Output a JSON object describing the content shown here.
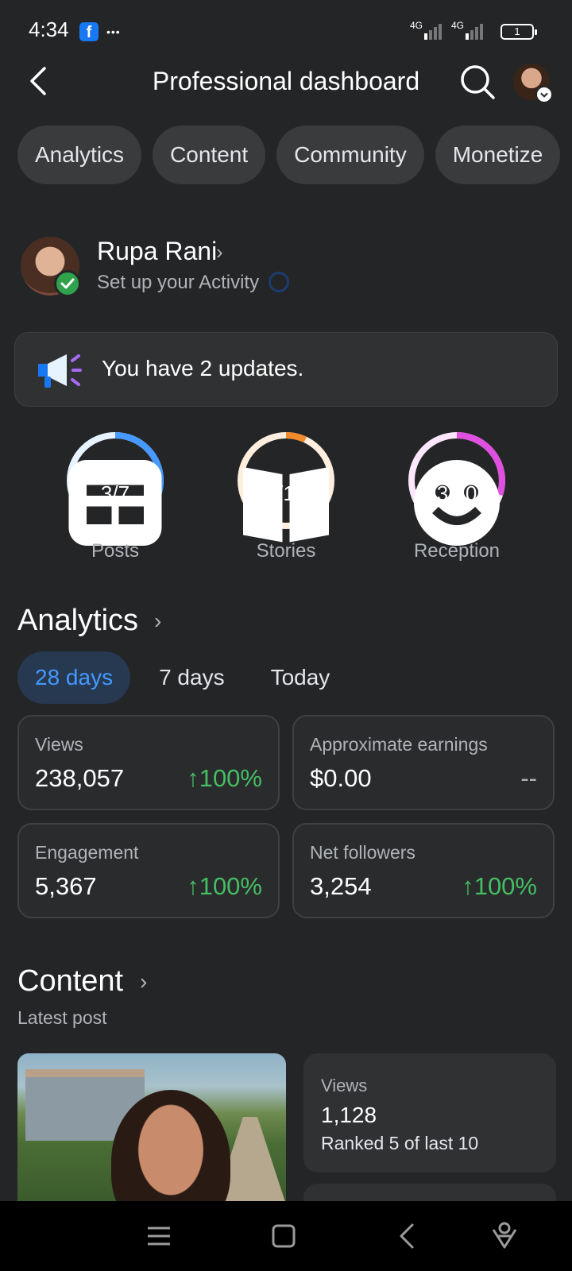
{
  "status_bar": {
    "time": "4:34",
    "app_badge": "f",
    "more_dots": "•••",
    "network_1": "4G",
    "network_2": "4G",
    "battery": "1"
  },
  "header": {
    "title": "Professional dashboard"
  },
  "chips": [
    {
      "label": "Analytics"
    },
    {
      "label": "Content"
    },
    {
      "label": "Community"
    },
    {
      "label": "Monetize"
    }
  ],
  "profile": {
    "name": "Rupa Rani",
    "subtitle": "Set up your Activity"
  },
  "updates": {
    "text": "You have 2 updates."
  },
  "progress": [
    {
      "label": "Posts",
      "value_text": "3/7",
      "fraction": 0.43,
      "color": "#4599ff",
      "track": "#e7f3ff"
    },
    {
      "label": "Stories",
      "value_text": "1/14",
      "fraction": 0.07,
      "color": "#f28a2e",
      "track": "#fdeede"
    },
    {
      "label": "Reception",
      "value_text": "3/10",
      "fraction": 0.3,
      "color": "#e050e0",
      "track": "#fbe6fb"
    }
  ],
  "analytics": {
    "title": "Analytics",
    "ranges": [
      "28 days",
      "7 days",
      "Today"
    ],
    "active_range": "28 days",
    "stats": [
      {
        "label": "Views",
        "value": "238,057",
        "change": "↑100%"
      },
      {
        "label": "Approximate earnings",
        "value": "$0.00",
        "change": "--"
      },
      {
        "label": "Engagement",
        "value": "5,367",
        "change": "↑100%"
      },
      {
        "label": "Net followers",
        "value": "3,254",
        "change": "↑100%"
      }
    ]
  },
  "content": {
    "title": "Content",
    "subtitle": "Latest post",
    "latest": {
      "label": "Views",
      "value": "1,128",
      "rank": "Ranked 5 of last 10"
    }
  },
  "colors": {
    "background": "#242527",
    "accent": "#4599ff",
    "positive": "#45bd62"
  }
}
